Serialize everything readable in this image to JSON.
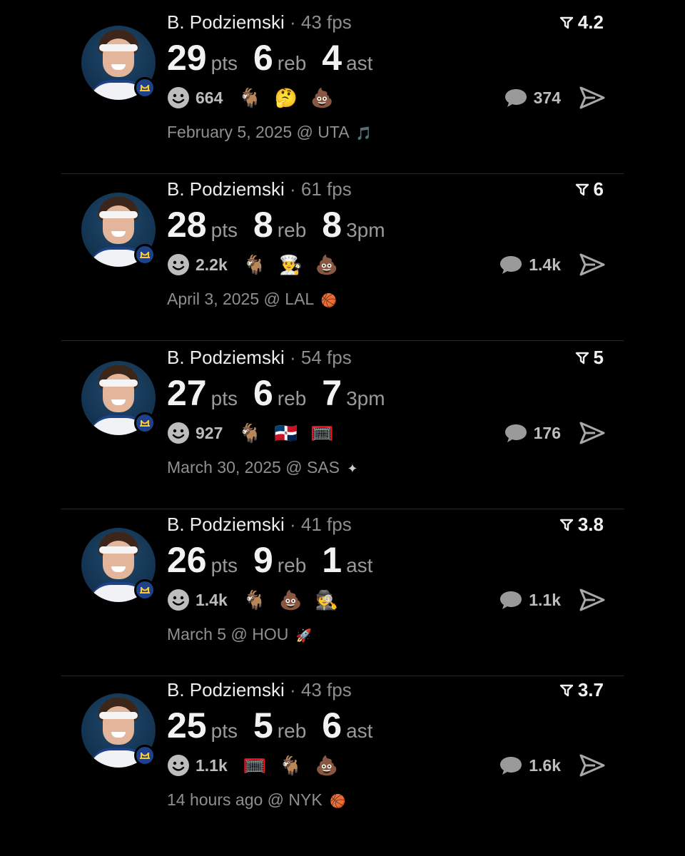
{
  "cards": [
    {
      "player_name": "B. Podziemski",
      "separator": "·",
      "fps": "43 fps",
      "rating": "4.2",
      "stats": [
        {
          "value": "29",
          "unit": "pts"
        },
        {
          "value": "6",
          "unit": "reb"
        },
        {
          "value": "4",
          "unit": "ast"
        }
      ],
      "reaction_count": "664",
      "emojis": [
        "🐐",
        "🤔",
        "💩"
      ],
      "comment_count": "374",
      "date_text": "February 5, 2025 @ UTA",
      "team_logo_glyph": "🎵",
      "team_logo_color": "#7b3fc4"
    },
    {
      "player_name": "B. Podziemski",
      "separator": "·",
      "fps": "61 fps",
      "rating": "6",
      "stats": [
        {
          "value": "28",
          "unit": "pts"
        },
        {
          "value": "8",
          "unit": "reb"
        },
        {
          "value": "8",
          "unit": "3pm"
        }
      ],
      "reaction_count": "2.2k",
      "emojis": [
        "🐐",
        "👨‍🍳",
        "💩"
      ],
      "comment_count": "1.4k",
      "date_text": "April 3, 2025 @ LAL",
      "team_logo_glyph": "🏀",
      "team_logo_color": "#f9a01b"
    },
    {
      "player_name": "B. Podziemski",
      "separator": "·",
      "fps": "54 fps",
      "rating": "5",
      "stats": [
        {
          "value": "27",
          "unit": "pts"
        },
        {
          "value": "6",
          "unit": "reb"
        },
        {
          "value": "7",
          "unit": "3pm"
        }
      ],
      "reaction_count": "927",
      "emojis": [
        "🐐",
        "🇩🇴",
        "🥅"
      ],
      "comment_count": "176",
      "date_text": "March 30, 2025 @ SAS",
      "team_logo_glyph": "✦",
      "team_logo_color": "#c4ced4"
    },
    {
      "player_name": "B. Podziemski",
      "separator": "·",
      "fps": "41 fps",
      "rating": "3.8",
      "stats": [
        {
          "value": "26",
          "unit": "pts"
        },
        {
          "value": "9",
          "unit": "reb"
        },
        {
          "value": "1",
          "unit": "ast"
        }
      ],
      "reaction_count": "1.4k",
      "emojis": [
        "🐐",
        "💩",
        "🕵️"
      ],
      "comment_count": "1.1k",
      "date_text": "March 5 @ HOU",
      "team_logo_glyph": "🚀",
      "team_logo_color": "#ce1141"
    },
    {
      "player_name": "B. Podziemski",
      "separator": "·",
      "fps": "43 fps",
      "rating": "3.7",
      "stats": [
        {
          "value": "25",
          "unit": "pts"
        },
        {
          "value": "5",
          "unit": "reb"
        },
        {
          "value": "6",
          "unit": "ast"
        }
      ],
      "reaction_count": "1.1k",
      "emojis": [
        "🥅",
        "🐐",
        "💩"
      ],
      "comment_count": "1.6k",
      "date_text": "14 hours ago @ NYK",
      "team_logo_glyph": "🏀",
      "team_logo_color": "#f58426"
    }
  ],
  "colors": {
    "background": "#000000",
    "primary_text": "#ededed",
    "secondary_text": "#8f8f8f",
    "team_badge": "#1d428a",
    "team_badge_accent": "#ffc72c"
  },
  "icons": {
    "rating": "filter-arrow-icon",
    "reaction": "smiley-icon",
    "comment": "speech-bubble-icon",
    "share": "send-arrow-icon",
    "team": "warriors-bridge-icon"
  }
}
